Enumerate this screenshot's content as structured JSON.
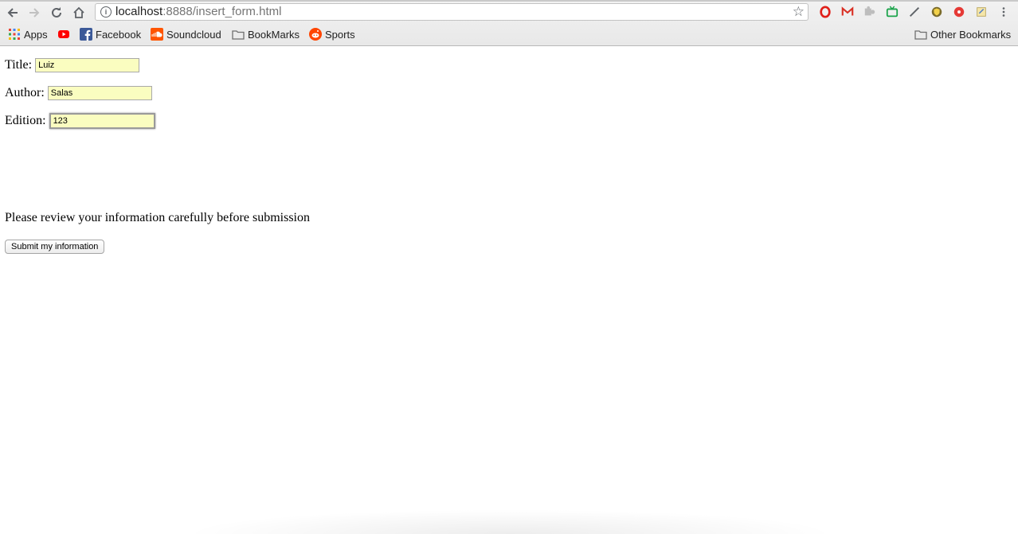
{
  "browser": {
    "url_host": "localhost",
    "url_rest": ":8888/insert_form.html",
    "info_glyph": "i",
    "icons": [
      "back-icon",
      "forward-icon",
      "reload-icon",
      "home-icon",
      "info-icon",
      "star-icon"
    ],
    "extensions": [
      "opera-icon",
      "gmail-icon",
      "puzzle-icon",
      "tv-icon",
      "pen-icon",
      "shield-icon",
      "record-icon",
      "note-icon",
      "menu-icon"
    ]
  },
  "bookmarks": {
    "items": [
      {
        "label": "Apps",
        "icon": "apps-grid-icon"
      },
      {
        "label": "",
        "icon": "youtube-icon"
      },
      {
        "label": "Facebook",
        "icon": "facebook-icon"
      },
      {
        "label": "Soundcloud",
        "icon": "soundcloud-icon"
      },
      {
        "label": "BookMarks",
        "icon": "folder-icon"
      },
      {
        "label": "Sports",
        "icon": "reddit-icon"
      }
    ],
    "other": "Other Bookmarks"
  },
  "form": {
    "title_label": "Title:",
    "title_value": "Luiz",
    "author_label": "Author:",
    "author_value": "Salas",
    "edition_label": "Edition:",
    "edition_value": "123",
    "notice": "Please review your information carefully before submission",
    "submit_label": "Submit my information"
  },
  "colors": {
    "input_autofill_bg": "#fafdc0",
    "youtube_red": "#ff0000",
    "facebook_blue": "#3b5998",
    "soundcloud_orange": "#ff5500",
    "reddit_orange": "#ff4500"
  }
}
